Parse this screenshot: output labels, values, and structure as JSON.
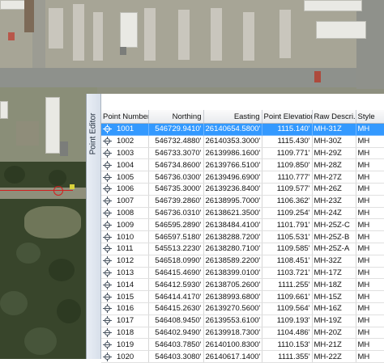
{
  "panel": {
    "title": "Point Editor"
  },
  "columns": [
    "Point Number",
    "Northing",
    "Easting",
    "Point Elevation",
    "Raw Descri...",
    "Style"
  ],
  "rows": [
    {
      "num": "1001",
      "north": "546729.9410'",
      "east": "26140654.5800'",
      "elev": "1115.140'",
      "desc": "MH-31Z",
      "style": "MH",
      "selected": true
    },
    {
      "num": "1002",
      "north": "546732.4880'",
      "east": "26140353.3000'",
      "elev": "1115.430'",
      "desc": "MH-30Z",
      "style": "MH",
      "selected": false
    },
    {
      "num": "1003",
      "north": "546733.3070'",
      "east": "26139986.1600'",
      "elev": "1109.771'",
      "desc": "MH-29Z",
      "style": "MH",
      "selected": false
    },
    {
      "num": "1004",
      "north": "546734.8600'",
      "east": "26139766.5100'",
      "elev": "1109.850'",
      "desc": "MH-28Z",
      "style": "MH",
      "selected": false
    },
    {
      "num": "1005",
      "north": "546736.0300'",
      "east": "26139496.6900'",
      "elev": "1110.777'",
      "desc": "MH-27Z",
      "style": "MH",
      "selected": false
    },
    {
      "num": "1006",
      "north": "546735.3000'",
      "east": "26139236.8400'",
      "elev": "1109.577'",
      "desc": "MH-26Z",
      "style": "MH",
      "selected": false
    },
    {
      "num": "1007",
      "north": "546739.2860'",
      "east": "26138995.7000'",
      "elev": "1106.362'",
      "desc": "MH-23Z",
      "style": "MH",
      "selected": false
    },
    {
      "num": "1008",
      "north": "546736.0310'",
      "east": "26138621.3500'",
      "elev": "1109.254'",
      "desc": "MH-24Z",
      "style": "MH",
      "selected": false
    },
    {
      "num": "1009",
      "north": "546595.2890'",
      "east": "26138484.4100'",
      "elev": "1101.791'",
      "desc": "MH-25Z-C",
      "style": "MH",
      "selected": false
    },
    {
      "num": "1010",
      "north": "546597.5180'",
      "east": "26138288.7200'",
      "elev": "1105.531'",
      "desc": "MH-25Z-B",
      "style": "MH",
      "selected": false
    },
    {
      "num": "1011",
      "north": "545513.2230'",
      "east": "26138280.7100'",
      "elev": "1109.585'",
      "desc": "MH-25Z-A",
      "style": "MH",
      "selected": false
    },
    {
      "num": "1012",
      "north": "546518.0990'",
      "east": "26138589.2200'",
      "elev": "1108.451'",
      "desc": "MH-32Z",
      "style": "MH",
      "selected": false
    },
    {
      "num": "1013",
      "north": "546415.4690'",
      "east": "26138399.0100'",
      "elev": "1103.721'",
      "desc": "MH-17Z",
      "style": "MH",
      "selected": false
    },
    {
      "num": "1014",
      "north": "546412.5930'",
      "east": "26138705.2600'",
      "elev": "1111.255'",
      "desc": "MH-18Z",
      "style": "MH",
      "selected": false
    },
    {
      "num": "1015",
      "north": "546414.4170'",
      "east": "26138993.6800'",
      "elev": "1109.661'",
      "desc": "MH-15Z",
      "style": "MH",
      "selected": false
    },
    {
      "num": "1016",
      "north": "546415.2630'",
      "east": "26139270.5600'",
      "elev": "1109.564'",
      "desc": "MH-16Z",
      "style": "MH",
      "selected": false
    },
    {
      "num": "1017",
      "north": "546408.9450'",
      "east": "26139553.6100'",
      "elev": "1109.193'",
      "desc": "MH-19Z",
      "style": "MH",
      "selected": false
    },
    {
      "num": "1018",
      "north": "546402.9490'",
      "east": "26139918.7300'",
      "elev": "1104.486'",
      "desc": "MH-20Z",
      "style": "MH",
      "selected": false
    },
    {
      "num": "1019",
      "north": "546403.7850'",
      "east": "26140100.8300'",
      "elev": "1110.153'",
      "desc": "MH-21Z",
      "style": "MH",
      "selected": false
    },
    {
      "num": "1020",
      "north": "546403.3080'",
      "east": "26140617.1400'",
      "elev": "1111.355'",
      "desc": "MH-22Z",
      "style": "MH",
      "selected": false
    }
  ]
}
